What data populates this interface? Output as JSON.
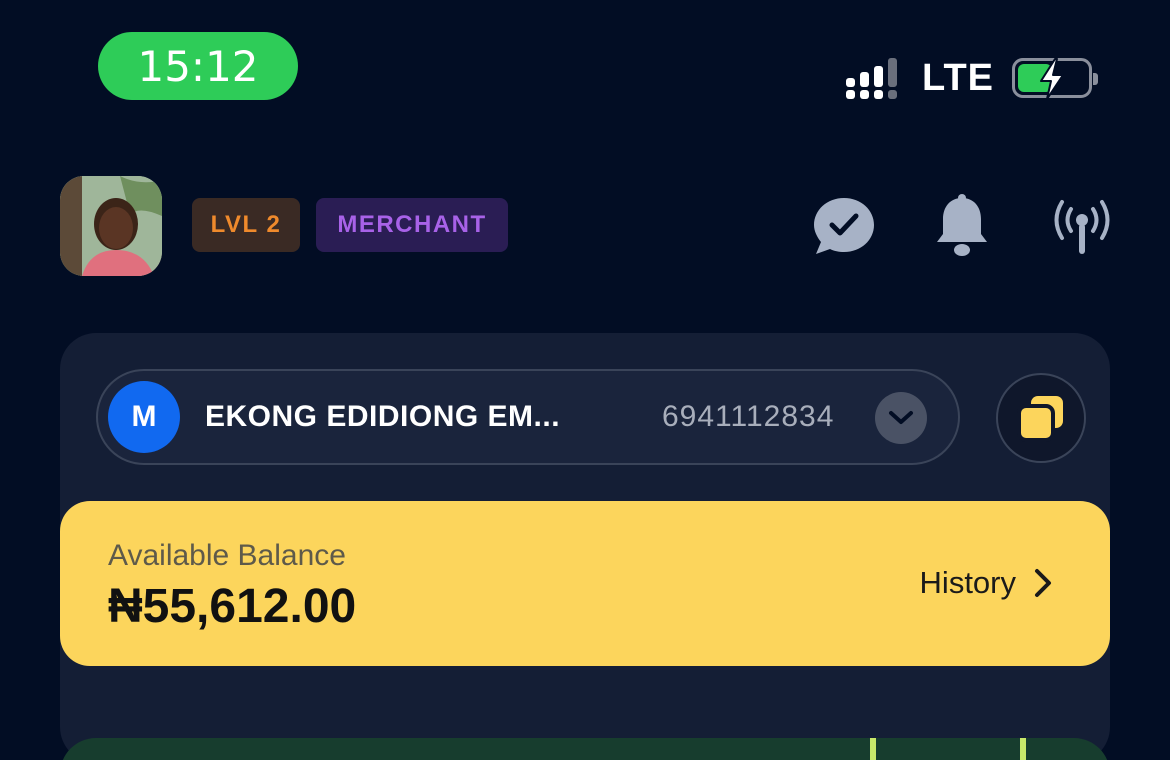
{
  "status_bar": {
    "time": "15:12",
    "network": "LTE"
  },
  "header": {
    "level_badge": "LVL 2",
    "role_badge": "MERCHANT"
  },
  "account": {
    "initial": "M",
    "name": "EKONG EDIDIONG EM...",
    "number": "6941112834"
  },
  "balance": {
    "label": "Available Balance",
    "amount": "₦55,612.00",
    "history_label": "History"
  },
  "colors": {
    "background": "#020d24",
    "accent_yellow": "#fcd55c",
    "status_green": "#2ecc58",
    "bank_blue": "#1169f0"
  }
}
